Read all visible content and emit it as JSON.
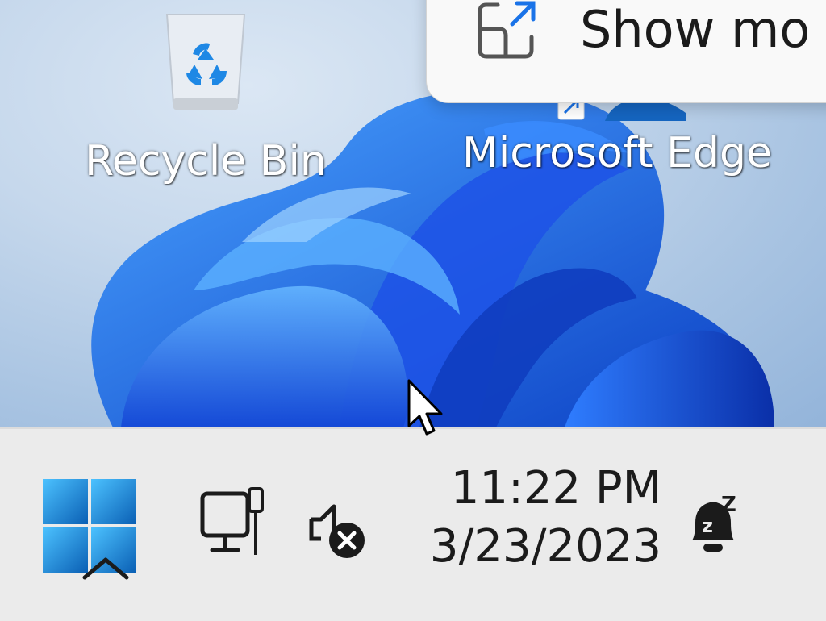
{
  "desktop": {
    "icons": [
      {
        "label": "Recycle Bin",
        "icon": "recycle-bin-icon"
      },
      {
        "label": "Microsoft Edge",
        "icon": "edge-shortcut-icon"
      }
    ]
  },
  "context_menu": {
    "item_label": "Show mo",
    "item_icon": "open-in-new-icon"
  },
  "taskbar": {
    "start_icon": "windows-start-icon",
    "overflow_icon": "chevron-up-icon",
    "network_icon": "network-ethernet-icon",
    "volume_icon": "volume-muted-icon",
    "clock": {
      "time": "11:22 PM",
      "date": "3/23/2023"
    },
    "notifications_icon": "notification-bell-snooze-icon"
  },
  "colors": {
    "accent_blue": "#1a73e8",
    "taskbar_bg": "#ebebeb",
    "menu_bg": "#f9f9f9",
    "start_blue_light": "#4cc2ff",
    "start_blue_dark": "#0a5fb4"
  }
}
